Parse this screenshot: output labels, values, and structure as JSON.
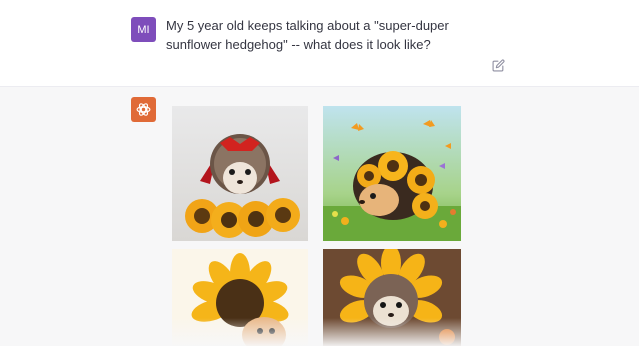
{
  "user": {
    "avatar_initials": "MI",
    "avatar_color": "#7e4dbb",
    "message": "My 5 year old keeps talking about a \"super-duper sunflower hedgehog\" -- what does it look like?",
    "edit_icon": "edit-icon"
  },
  "assistant": {
    "avatar_icon": "openai-logo-icon",
    "avatar_color": "#e06a37",
    "images": [
      {
        "subject": "hedgehog with red mask and cape behind sunflowers"
      },
      {
        "subject": "cartoon hedgehog with sunflower spines and butterflies"
      },
      {
        "subject": "sunflower with hedgehog face"
      },
      {
        "subject": "hedgehog inside sunflower"
      }
    ]
  },
  "colors": {
    "page_bg": "#f7f7f8",
    "user_bg": "#ffffff",
    "text": "#343541"
  }
}
